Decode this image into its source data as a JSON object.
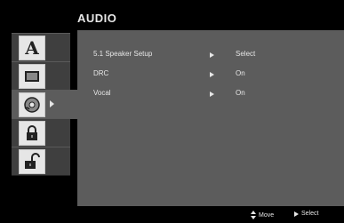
{
  "menu": {
    "title": "AUDIO"
  },
  "tabs": [
    {
      "name": "language",
      "icon": "letter-a-icon",
      "glyph": "A"
    },
    {
      "name": "display",
      "icon": "tv-screen-icon"
    },
    {
      "name": "audio",
      "icon": "disc-audio-icon",
      "active": true
    },
    {
      "name": "parental-lock",
      "icon": "padlock-icon"
    },
    {
      "name": "other",
      "icon": "unlocked-padlock-icon"
    }
  ],
  "settings": [
    {
      "label": "5.1 Speaker Setup",
      "value": "Select"
    },
    {
      "label": "DRC",
      "value": "On"
    },
    {
      "label": "Vocal",
      "value": "On"
    }
  ],
  "footer": {
    "move_label": "Move",
    "select_label": "Select"
  },
  "colors": {
    "panel": "#5c5c5c",
    "tab": "#3f3f3f",
    "text": "#e6e6e6",
    "background": "#000000"
  }
}
